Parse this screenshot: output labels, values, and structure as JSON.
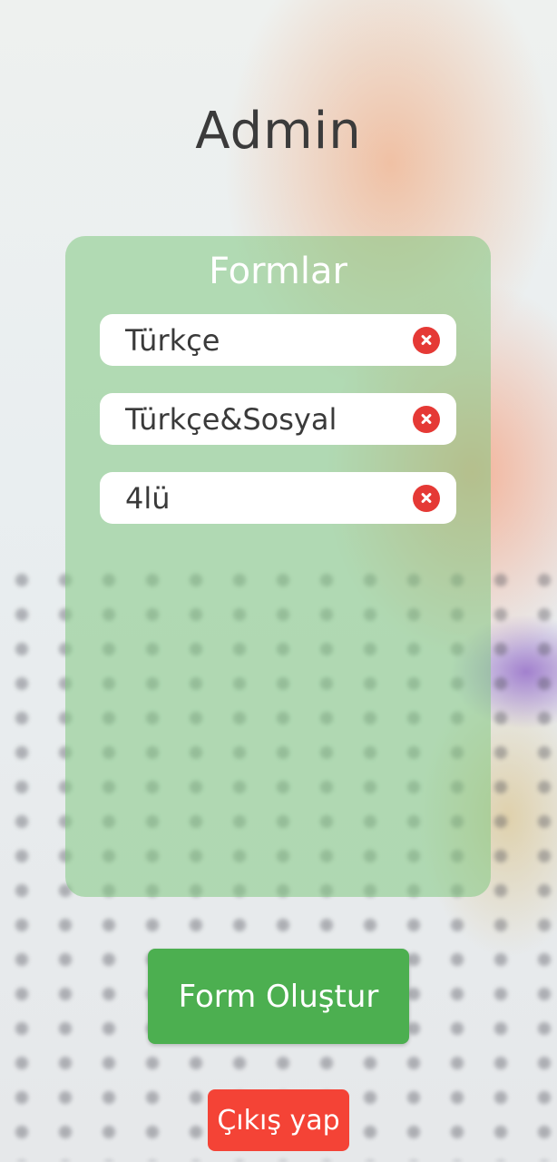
{
  "header": {
    "title": "Admin"
  },
  "forms_panel": {
    "title": "Formlar",
    "items": [
      {
        "label": "Türkçe",
        "delete_icon": "close-circle-icon"
      },
      {
        "label": "Türkçe&Sosyal",
        "delete_icon": "close-circle-icon"
      },
      {
        "label": "4lü",
        "delete_icon": "close-circle-icon"
      }
    ]
  },
  "actions": {
    "create_form_label": "Form Oluştur",
    "logout_label": "Çıkış yap"
  },
  "colors": {
    "panel_green": "#82c882",
    "create_button": "#4caf50",
    "logout_button": "#f44336",
    "delete_icon": "#e53935"
  }
}
